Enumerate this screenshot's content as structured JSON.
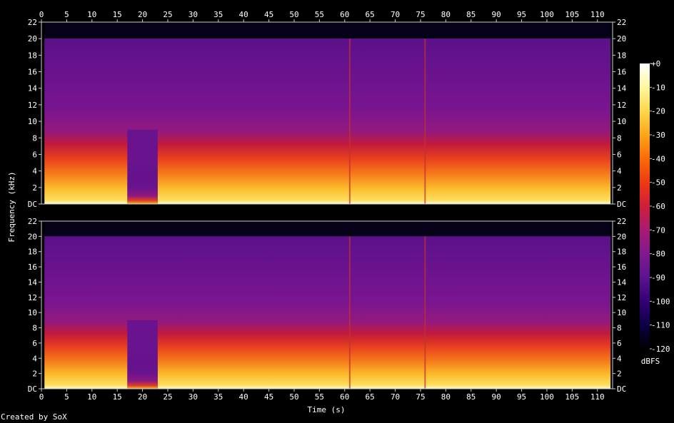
{
  "chart_data": {
    "type": "heatmap",
    "xlabel": "Time (s)",
    "ylabel": "Frequency (kHz)",
    "colorbar_label": "dBFS",
    "xlim": [
      0,
      113
    ],
    "ylim": [
      0,
      22
    ],
    "x_ticks": [
      0,
      5,
      10,
      15,
      20,
      25,
      30,
      35,
      40,
      45,
      50,
      55,
      60,
      65,
      70,
      75,
      80,
      85,
      90,
      95,
      100,
      105,
      110
    ],
    "y_ticks": [
      "DC",
      "2",
      "4",
      "6",
      "8",
      "10",
      "12",
      "14",
      "16",
      "18",
      "20",
      "22"
    ],
    "colorbar_ticks": [
      "+0",
      "-10",
      "-20",
      "-30",
      "-40",
      "-50",
      "-60",
      "-70",
      "-80",
      "-90",
      "-100",
      "-110",
      "-120"
    ],
    "colorbar_range_dbfs": [
      -120,
      0
    ],
    "channels": 2,
    "signal_extent_s": [
      0.6,
      112.6
    ],
    "spectrum_cutoff_khz": 20,
    "colors": {
      "background": "#000000",
      "axis": "#cccccc",
      "text": "#ffffff",
      "colormap": [
        "#000000",
        "#0d0045",
        "#340077",
        "#5c148f",
        "#80198f",
        "#a81b72",
        "#cf1f3a",
        "#ef3a12",
        "#fb6b08",
        "#fda51a",
        "#fdd84a",
        "#fff7a0",
        "#ffffff"
      ]
    }
  },
  "footer": {
    "credit": "Created by SoX"
  }
}
